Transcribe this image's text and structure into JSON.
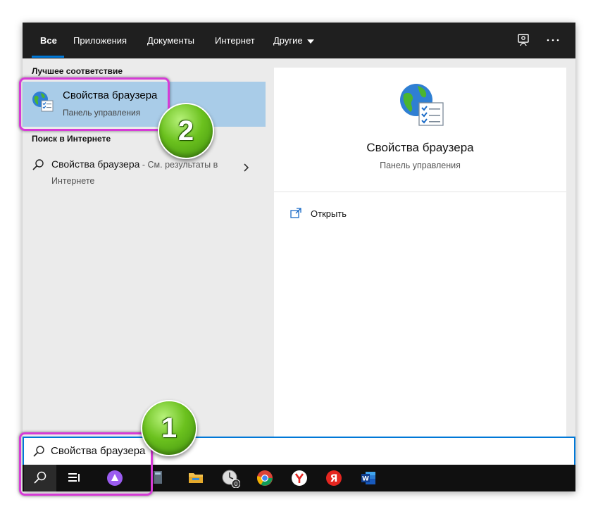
{
  "tabs": [
    {
      "label": "Все"
    },
    {
      "label": "Приложения"
    },
    {
      "label": "Документы"
    },
    {
      "label": "Интернет"
    },
    {
      "label": "Другие"
    }
  ],
  "top_icons": [
    "feedback-icon",
    "more-options-icon"
  ],
  "left": {
    "best_match_header": "Лучшее соответствие",
    "best_match": {
      "title": "Свойства браузера",
      "subtitle": "Панель управления",
      "icon": "internet-options-icon"
    },
    "web_header": "Поиск в Интернете",
    "web_result": {
      "title": "Свойства браузера",
      "suffix": " - См. результаты в Интернете"
    }
  },
  "preview": {
    "title": "Свойства браузера",
    "subtitle": "Панель управления",
    "actions": [
      {
        "label": "Открыть",
        "icon": "open-icon"
      }
    ]
  },
  "search": {
    "value": "Свойства браузера"
  },
  "taskbar": [
    "search-icon",
    "task-view-icon",
    "alice-icon",
    "calculator-icon",
    "file-explorer-icon",
    "clock-app-icon",
    "chrome-icon",
    "yandex-browser-icon",
    "yandex-icon",
    "word-icon"
  ],
  "annotations": {
    "step1": "1",
    "step2": "2"
  },
  "colors": {
    "accent": "#0078d7",
    "selection": "#a9cce8",
    "highlight": "#d63bd6",
    "badge": "#6bc11e"
  }
}
